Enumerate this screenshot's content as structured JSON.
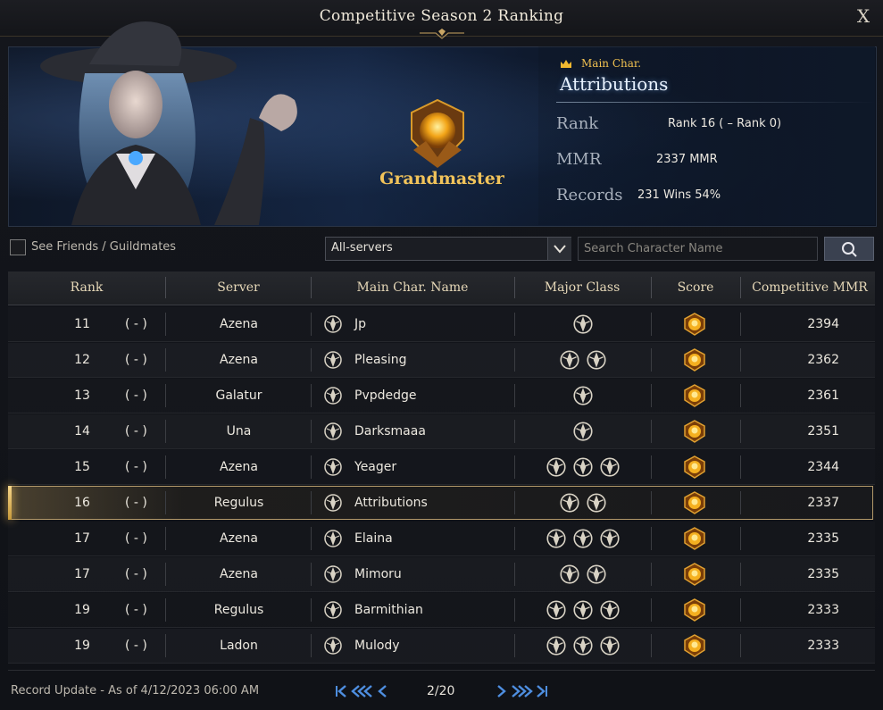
{
  "window": {
    "title": "Competitive Season 2 Ranking",
    "close_label": "X"
  },
  "profile": {
    "tier": "Grandmaster",
    "main_char_label": "Main Char.",
    "name": "Attributions",
    "stats": [
      {
        "label": "Rank",
        "value": "Rank 16 ( –  Rank 0)"
      },
      {
        "label": "MMR",
        "value": "2337 MMR"
      },
      {
        "label": "Records",
        "value": "231 Wins 54%"
      }
    ]
  },
  "filters": {
    "friends_label": "See Friends / Guildmates",
    "friends_checked": false,
    "server_select": "All-servers",
    "search_placeholder": "Search Character Name"
  },
  "table": {
    "headers": [
      "Rank",
      "Server",
      "Main Char. Name",
      "Major Class",
      "Score",
      "Competitive MMR"
    ],
    "rows": [
      {
        "rank": "11",
        "change": "( - )",
        "server": "Azena",
        "name": "Jp",
        "class_icon": "gunslinger-class-icon",
        "major": [
          "artillerist-class-icon"
        ],
        "mmr": "2394"
      },
      {
        "rank": "12",
        "change": "( - )",
        "server": "Azena",
        "name": "Pleasing",
        "class_icon": "bard-class-icon",
        "major": [
          "wardancer-class-icon",
          "berserker-class-icon"
        ],
        "mmr": "2362"
      },
      {
        "rank": "13",
        "change": "( - )",
        "server": "Galatur",
        "name": "Pvpdedge",
        "class_icon": "deathblade-class-icon",
        "major": [
          "deathblade-class-icon"
        ],
        "mmr": "2361"
      },
      {
        "rank": "14",
        "change": "( - )",
        "server": "Una",
        "name": "Darksmaaa",
        "class_icon": "wardancer-class-icon",
        "major": [
          "wardancer-class-icon"
        ],
        "mmr": "2351"
      },
      {
        "rank": "15",
        "change": "( - )",
        "server": "Azena",
        "name": "Yeager",
        "class_icon": "scrapper-class-icon",
        "major": [
          "scrapper-class-icon",
          "shadowhunter-class-icon",
          "paladin-class-icon"
        ],
        "mmr": "2344"
      },
      {
        "rank": "16",
        "change": "( - )",
        "server": "Regulus",
        "name": "Attributions",
        "class_icon": "sorceress-class-icon",
        "major": [
          "artillerist-class-icon",
          "sorceress-class-icon"
        ],
        "mmr": "2337",
        "selected": true
      },
      {
        "rank": "17",
        "change": "( - )",
        "server": "Azena",
        "name": "Elaina",
        "class_icon": "sorceress-class-icon",
        "major": [
          "paladin-class-icon",
          "sorceress-class-icon",
          "wardancer-class-icon"
        ],
        "mmr": "2335"
      },
      {
        "rank": "17",
        "change": "( - )",
        "server": "Azena",
        "name": "Mimoru",
        "class_icon": "soulfist-class-icon",
        "major": [
          "bard-class-icon",
          "soulfist-class-icon"
        ],
        "mmr": "2335"
      },
      {
        "rank": "19",
        "change": "( - )",
        "server": "Regulus",
        "name": "Barmithian",
        "class_icon": "striker-class-icon",
        "major": [
          "glaivier-class-icon",
          "gunslinger-class-icon",
          "scrapper-class-icon"
        ],
        "mmr": "2333"
      },
      {
        "rank": "19",
        "change": "( - )",
        "server": "Ladon",
        "name": "Mulody",
        "class_icon": "paladin-class-icon",
        "major": [
          "paladin-class-icon",
          "wardancer-class-icon",
          "shadowhunter-class-icon"
        ],
        "mmr": "2333"
      }
    ]
  },
  "footer": {
    "record_update": "Record Update - As of 4/12/2023 06:00 AM",
    "page": "2/20"
  },
  "colors": {
    "accent_gold": "#f1c35a",
    "pager_blue": "#4e8ee0",
    "selected_border": "#b3996a"
  }
}
